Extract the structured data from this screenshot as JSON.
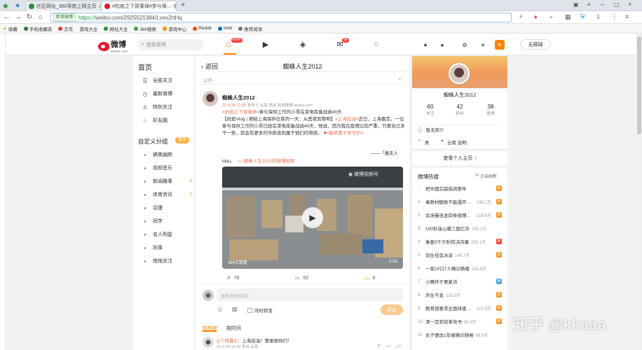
{
  "browser": {
    "tabs": [
      {
        "label": "社区网址_360导航上网主页",
        "icon_color": "#2a8f3c"
      },
      {
        "label": "#抗疫之下冒乘禅#参与保...- 微博",
        "icon_color": "#e6162d"
      }
    ],
    "address_badge": "新浪微博",
    "url_scheme": "https://",
    "url_rest": "weibo.com/2925521384/Lves2rtHq",
    "bookmarks": [
      "收藏",
      "手机收藏夹",
      "京东",
      "游戏大全",
      "网址大全",
      "360搜索",
      "游戏中心",
      "Reddit",
      "Intel",
      "推荐阅读"
    ]
  },
  "weibo_nav": {
    "logo_text": "微博",
    "logo_sub": "weibo.com",
    "search_placeholder": "搜索微博",
    "home_badge": "NEW",
    "msg_badge": "98",
    "no_barrier": "无障碍"
  },
  "sidenav": {
    "home": "首页",
    "items": [
      {
        "label": "全部关注",
        "icon": "list-icon"
      },
      {
        "label": "最新微博",
        "icon": "clock-icon"
      },
      {
        "label": "特别关注",
        "icon": "user-icon"
      },
      {
        "label": "好友圈",
        "icon": "friends-icon"
      }
    ],
    "groups_title": "自定义分组",
    "manage": "管理",
    "groups": [
      {
        "label": "搞笑幽默",
        "count": ""
      },
      {
        "label": "视频音乐",
        "count": ""
      },
      {
        "label": "新闻趣事",
        "count": "4"
      },
      {
        "label": "体育资讯",
        "count": "1"
      },
      {
        "label": "动漫",
        "count": ""
      },
      {
        "label": "同学",
        "count": ""
      },
      {
        "label": "名人明星",
        "count": ""
      },
      {
        "label": "同事",
        "count": ""
      },
      {
        "label": "悄悄关注",
        "count": ""
      }
    ]
  },
  "post_header": {
    "back": "返回",
    "title": "蜘蛛人生2012",
    "visibility": "公开"
  },
  "post": {
    "author": "蜘蛛人生2012",
    "time": "22-5-29 12:20",
    "from": "发布于 云南 来自 新浪微博 weibo.com",
    "topic": "#抗疫之下冒乘禅#",
    "line1_rest": "参与保供工作的小哥在菜电库备战逾40天",
    "body": "【抗疫Vlog | 揭秘上海保供仓库的一天：从黑夜到黎明】",
    "location_tag": "#上海加油#",
    "body2": "近日，上海嘉定。一位参与保供工作的小哥已经在菜电库备战逾40天，他说，因为我在疫情比较严重，只要自己多干一些，就会有更多的市民收到属于他们的物资。",
    "tag2": "#能供靠子来守护#",
    "quote_end": "——「骆夫人",
    "quote_name": "lola」",
    "video_link": "蜘蛛人生2012的微博视频",
    "video_watermark": "微博视频号",
    "views": "484次观看",
    "duration": "2:52",
    "reposts": "76",
    "comments": "52",
    "likes": "8"
  },
  "comment_box": {
    "placeholder": "发布你的评论",
    "also_repost": "同时转发",
    "submit": "评论"
  },
  "comment_tabs": {
    "hot": "按热度",
    "time": "按时间"
  },
  "first_comment": {
    "name": "Q丫特曼Q",
    "text": "上海加油！要谢谢你们！",
    "time": "22-5-29 12:30 来自 云南"
  },
  "profile": {
    "name": "蜘蛛人生2012",
    "follow": "60",
    "follow_label": "关注",
    "fans": "42",
    "fans_label": "粉丝",
    "posts": "38",
    "posts_label": "微博",
    "intro": "暂无简介",
    "gender": "男",
    "location": "云南 昆明",
    "more": "查看个人主页"
  },
  "hot_search": {
    "title": "微博热搜",
    "refresh": "点击刷新",
    "items": [
      {
        "rank": "",
        "title": "把中国宗崩捐谛要牢",
        "count": "",
        "tag": "热",
        "tag_color": "#f7941d"
      },
      {
        "rank": "1",
        "title": "毒救材酸致不能遏开道…",
        "count": "345.1万",
        "tag": "热",
        "tag_color": "#f7941d"
      },
      {
        "rank": "2",
        "title": "余诗曼连发四条微博回应",
        "count": "319.6万",
        "tag": "热",
        "tag_color": "#f7941d"
      },
      {
        "rank": "3",
        "title": "100秒连心曝三国亿亦",
        "count": "235.1万",
        "tag": "",
        "tag_color": ""
      },
      {
        "rank": "4",
        "title": "乘查5千万秒较决内幕",
        "count": "205.1万",
        "tag": "新",
        "tag_color": "#ff3b30"
      },
      {
        "rank": "5",
        "title": "羽生结弦冰演",
        "count": "144.7万",
        "tag": "热",
        "tag_color": "#f7941d"
      },
      {
        "rank": "6",
        "title": "一家10口7人确诊肠瘤",
        "count": "142.6万",
        "tag": "",
        "tag_color": ""
      },
      {
        "rank": "7",
        "title": "小舞终于要复活",
        "count": "",
        "tag": "新",
        "tag_color": "#4aa3df"
      },
      {
        "rank": "8",
        "title": "声生不息",
        "count": "116.3万",
        "tag": "热",
        "tag_color": "#f7941d"
      },
      {
        "rank": "9",
        "title": "教育部要求全面排查金…",
        "count": "107.9万",
        "tag": "热",
        "tag_color": "#f7941d"
      },
      {
        "rank": "10",
        "title": "清一定到突来攻书",
        "count": "95.2万",
        "tag": "热",
        "tag_color": "#f7941d"
      },
      {
        "rank": "11",
        "title": "女子便血1年被确诊肠癌",
        "count": "89.9万",
        "tag": "",
        "tag_color": ""
      }
    ]
  },
  "watermark": "知乎 @kkaaa"
}
